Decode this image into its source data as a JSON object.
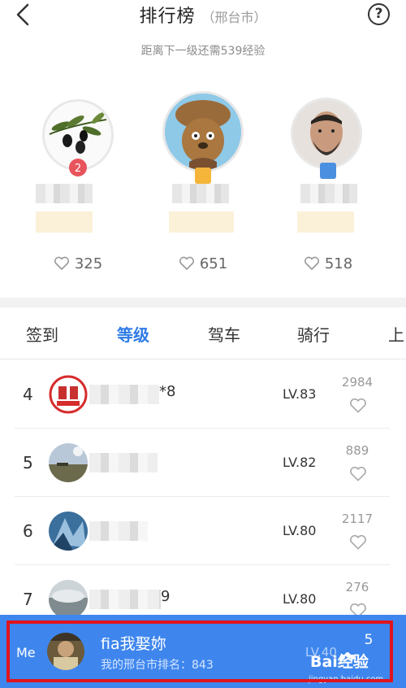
{
  "header": {
    "title": "排行榜",
    "city": "（邢台市）",
    "help_label": "?"
  },
  "subtitle": "距离下一级还需539经验",
  "podium": [
    {
      "likes": "325"
    },
    {
      "likes": "651"
    },
    {
      "likes": "518"
    }
  ],
  "tabs": [
    {
      "label": "签到",
      "active": false
    },
    {
      "label": "等级",
      "active": true
    },
    {
      "label": "驾车",
      "active": false
    },
    {
      "label": "骑行",
      "active": false
    },
    {
      "label": "上",
      "active": false
    }
  ],
  "ranking": [
    {
      "rank": "4",
      "name_tail": "*8",
      "level": "LV.83",
      "count": "2984"
    },
    {
      "rank": "5",
      "name_tail": "",
      "level": "LV.82",
      "count": "889"
    },
    {
      "rank": "6",
      "name_tail": "",
      "level": "LV.80",
      "count": "2117"
    },
    {
      "rank": "7",
      "name_tail": "9",
      "level": "LV.80",
      "count": "276"
    }
  ],
  "me": {
    "label": "Me",
    "name": "fia我娶妳",
    "rank_text": "我的邢台市排名：843",
    "level": "LV.40",
    "count": "5"
  },
  "watermark": {
    "logo": "Bai经验",
    "url": "jingyan.baidu.com"
  },
  "colors": {
    "accent": "#2f7be6",
    "me_bar": "#3e86ee",
    "highlight": "#e0141e"
  }
}
